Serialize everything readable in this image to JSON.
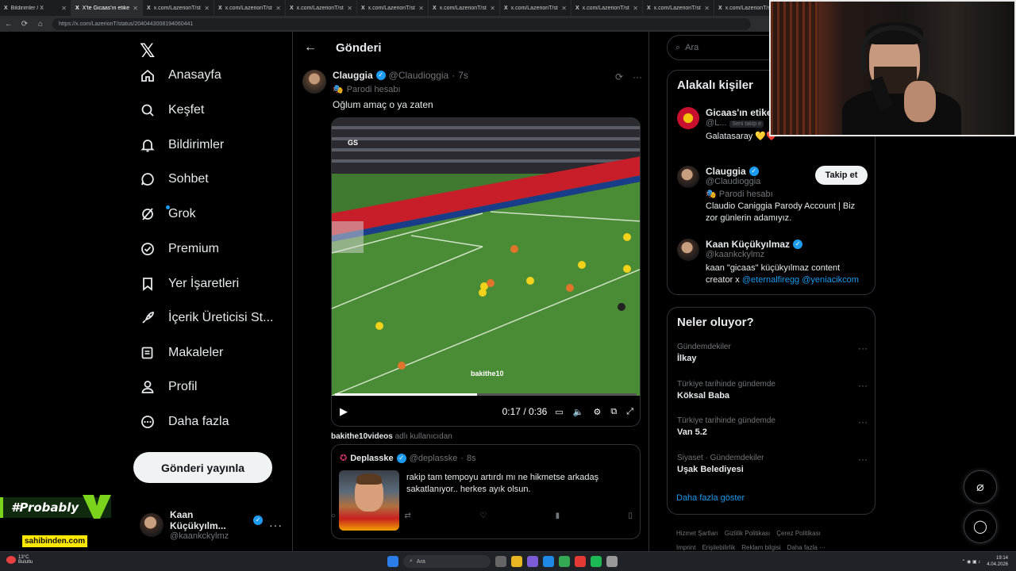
{
  "browser": {
    "tabs": [
      {
        "label": "Bildirimler / X"
      },
      {
        "label": "X'te Gicaas'ın etiketçisi"
      },
      {
        "label": "x.com/LazerionT/statu"
      },
      {
        "label": "x.com/LazerionT/statu"
      },
      {
        "label": "x.com/LazerionT/statu"
      },
      {
        "label": "x.com/LazerionT/statu"
      },
      {
        "label": "x.com/LazerionT/statu"
      },
      {
        "label": "x.com/LazerionT/statu"
      },
      {
        "label": "x.com/LazerionT/statu"
      },
      {
        "label": "x.com/LazerionT/statu"
      },
      {
        "label": "x.com/LazerionT/statu"
      }
    ],
    "url": "https://x.com/LazerionT/status/2040443008194060441"
  },
  "nav": {
    "items": [
      {
        "label": "Anasayfa",
        "icon": "home-icon"
      },
      {
        "label": "Keşfet",
        "icon": "search-icon"
      },
      {
        "label": "Bildirimler",
        "icon": "bell-icon"
      },
      {
        "label": "Sohbet",
        "icon": "chat-icon"
      },
      {
        "label": "Grok",
        "icon": "grok-icon"
      },
      {
        "label": "Premium",
        "icon": "premium-icon"
      },
      {
        "label": "Yer İşaretleri",
        "icon": "bookmark-icon"
      },
      {
        "label": "İçerik Üreticisi St...",
        "icon": "rocket-icon"
      },
      {
        "label": "Makaleler",
        "icon": "article-icon"
      },
      {
        "label": "Profil",
        "icon": "profile-icon"
      },
      {
        "label": "Daha fazla",
        "icon": "more-circle-icon"
      }
    ],
    "post_button": "Gönderi yayınla",
    "account": {
      "name": "Kaan Küçükyılm...",
      "handle": "@kaankckylmz"
    }
  },
  "overlay": {
    "probably": "#Probably",
    "sahibinden": "sahibinden.com"
  },
  "main": {
    "title": "Gönderi",
    "post": {
      "name": "Clauggia",
      "handle": "@Claudioggia",
      "time": "7s",
      "badge": "Parodi hesabı",
      "text": "Oğlum amaç o ya zaten",
      "video": {
        "watermark": "GS",
        "caption": "bakithe10",
        "time": "0:17 / 0:36",
        "progress": 0.47
      },
      "attribution_user": "bakithe10videos",
      "attribution_suffix": "adlı kullanıcıdan",
      "quote": {
        "name": "Deplasske",
        "handle": "@deplasske",
        "time": "8s",
        "text": "rakip tam tempoyu artırdı mı ne hikmetse arkadaş sakatlanıyor.. herkes ayık olsun."
      }
    }
  },
  "right": {
    "search_placeholder": "Ara",
    "related_title": "Alakalı kişiler",
    "people": [
      {
        "name": "Gicaas'ın etike",
        "handle": "@L...",
        "follows_you": "Seni takip e",
        "bio": "Galatasaray 💛❤️"
      },
      {
        "name": "Clauggia",
        "handle": "@Claudioggia",
        "badge": "Parodi hesabı",
        "bio": "Claudio Caniggia Parody Account | Biz zor günlerin adamıyız.",
        "follow": "Takip et"
      },
      {
        "name": "Kaan Küçükyılmaz",
        "handle": "@kaankckylmz",
        "bio_text": "kaan \"gicaas\" küçükyılmaz content creator x ",
        "bio_link1": "@eternalfiregg",
        "bio_link2": "@yeniacikcom"
      }
    ],
    "trends_title": "Neler oluyor?",
    "trends": [
      {
        "context": "Gündemdekiler",
        "topic": "İlkay"
      },
      {
        "context": "Türkiye tarihinde gündemde",
        "topic": "Köksal Baba"
      },
      {
        "context": "Türkiye tarihinde gündemde",
        "topic": "Van 5.2"
      },
      {
        "context": "Siyaset · Gündemdekiler",
        "topic": "Uşak Belediyesi"
      }
    ],
    "show_more": "Daha fazla göster",
    "footer": [
      "Hizmet Şartları",
      "Gizlilik Politikası",
      "Çerez Politikası",
      "Imprint",
      "Erişilebilirlik",
      "Reklam bilgisi",
      "Daha fazla ···"
    ]
  },
  "taskbar": {
    "weather_temp": "13°C",
    "weather_desc": "Bulutlu",
    "search": "Ara",
    "time": "19:14",
    "date": "4.04.2026"
  }
}
